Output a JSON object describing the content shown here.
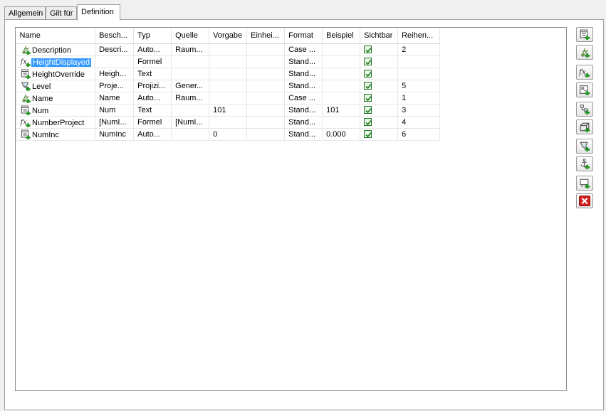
{
  "tabs": [
    {
      "label": "Allgemein"
    },
    {
      "label": "Gilt für"
    },
    {
      "label": "Definition"
    }
  ],
  "grid": {
    "columns": [
      {
        "label": "Name"
      },
      {
        "label": "Besch..."
      },
      {
        "label": "Typ"
      },
      {
        "label": "Quelle"
      },
      {
        "label": "Vorgabe"
      },
      {
        "label": "Einhei..."
      },
      {
        "label": "Format"
      },
      {
        "label": "Beispiel"
      },
      {
        "label": "Sichtbar"
      },
      {
        "label": "Reihen..."
      }
    ],
    "rows": [
      {
        "icon": "automatic-property-icon",
        "name": "Description",
        "desc": "Descri...",
        "type": "Auto...",
        "source": "Raum...",
        "default": "",
        "unit": "",
        "format": "Case ...",
        "example": "",
        "visible": true,
        "order": "2",
        "selected": false
      },
      {
        "icon": "formula-property-icon",
        "name": "HeightDisplayed",
        "desc": "",
        "type": "Formel",
        "source": "",
        "default": "",
        "unit": "",
        "format": "Stand...",
        "example": "",
        "visible": true,
        "order": "",
        "selected": true
      },
      {
        "icon": "text-property-icon",
        "name": "HeightOverride",
        "desc": "Heigh...",
        "type": "Text",
        "source": "",
        "default": "",
        "unit": "",
        "format": "Stand...",
        "example": "",
        "visible": true,
        "order": "",
        "selected": false
      },
      {
        "icon": "projection-property-icon",
        "name": "Level",
        "desc": "Proje...",
        "type": "Projizi...",
        "source": "Gener...",
        "default": "",
        "unit": "",
        "format": "Stand...",
        "example": "",
        "visible": true,
        "order": "5",
        "selected": false
      },
      {
        "icon": "automatic-property-icon",
        "name": "Name",
        "desc": "Name",
        "type": "Auto...",
        "source": "Raum...",
        "default": "",
        "unit": "",
        "format": "Case ...",
        "example": "",
        "visible": true,
        "order": "1",
        "selected": false
      },
      {
        "icon": "text-property-icon",
        "name": "Num",
        "desc": "Num",
        "type": "Text",
        "source": "",
        "default": "101",
        "unit": "",
        "format": "Stand...",
        "example": "101",
        "visible": true,
        "order": "3",
        "selected": false
      },
      {
        "icon": "formula-property-icon",
        "name": "NumberProject",
        "desc": "[NumI...",
        "type": "Formel",
        "source": "[NumI...",
        "default": "",
        "unit": "",
        "format": "Stand...",
        "example": "",
        "visible": true,
        "order": "4",
        "selected": false
      },
      {
        "icon": "text-property-icon",
        "name": "NumInc",
        "desc": "NumInc",
        "type": "Auto...",
        "source": "",
        "default": "0",
        "unit": "",
        "format": "Stand...",
        "example": "0.000",
        "visible": true,
        "order": "6",
        "selected": false
      }
    ]
  },
  "side_buttons": [
    {
      "icon": "add-text-property-icon"
    },
    {
      "icon": "add-automatic-property-icon"
    },
    {
      "icon": "add-formula-property-icon"
    },
    {
      "icon": "add-location-property-icon"
    },
    {
      "icon": "add-classification-property-icon"
    },
    {
      "icon": "add-material-property-icon"
    },
    {
      "icon": "add-projection-property-icon"
    },
    {
      "icon": "add-anchor-property-icon"
    },
    {
      "icon": "add-graphic-property-icon"
    },
    {
      "icon": "delete-icon"
    }
  ],
  "colors": {
    "selection": "#3399ff",
    "check": "#1e7a1e",
    "plus": "#1f9e1f",
    "delete": "#d42020",
    "automatic_icon": "#5a8a3a"
  }
}
